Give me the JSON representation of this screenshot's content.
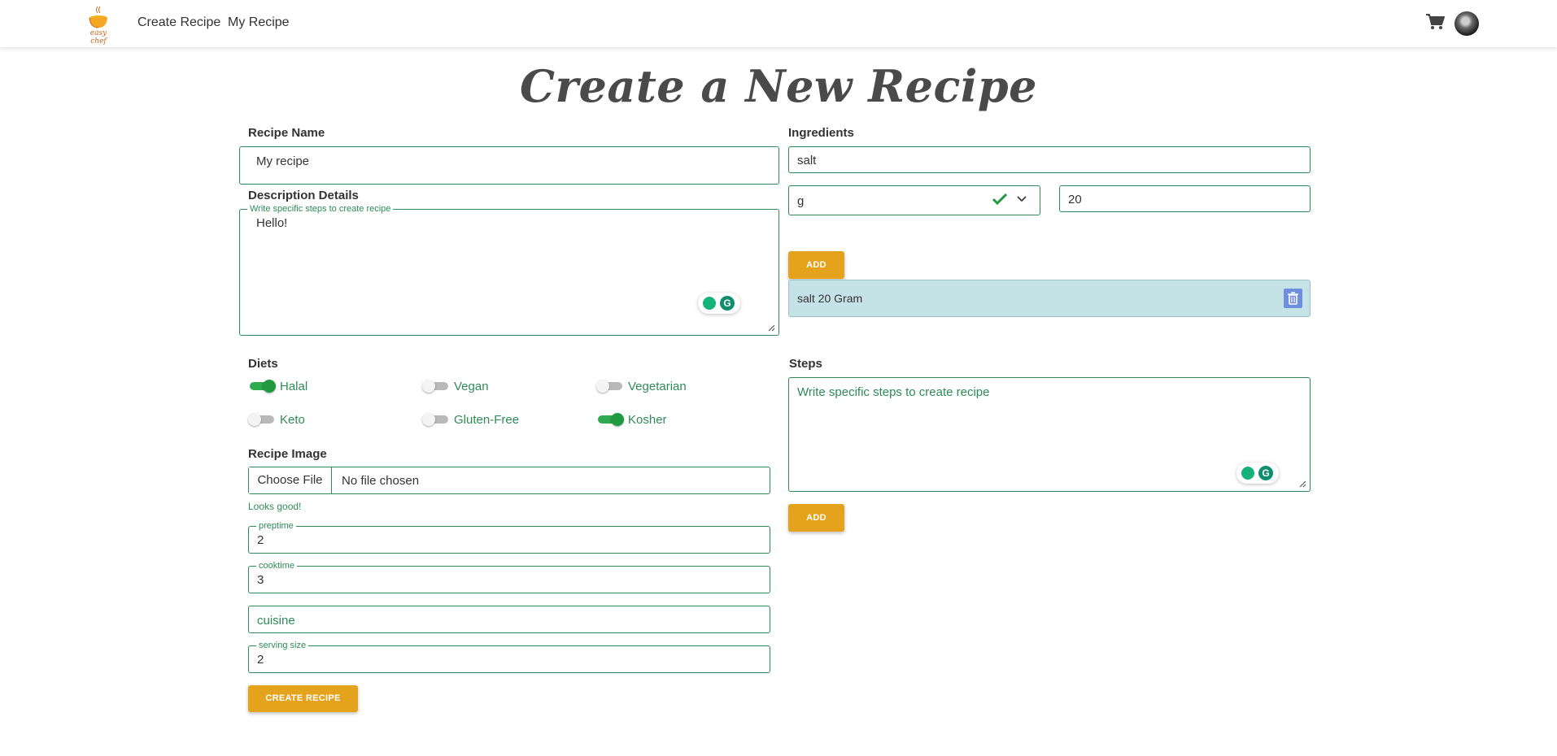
{
  "nav": {
    "logo_text": "easy chef",
    "create_recipe": "Create Recipe",
    "my_recipe": "My Recipe"
  },
  "page_title": "Create a New Recipe",
  "recipe_name": {
    "label": "Recipe Name",
    "value": "My recipe"
  },
  "description": {
    "label": "Description Details",
    "legend": "Write specific steps to create recipe",
    "value": "Hello!"
  },
  "ingredients": {
    "label": "Ingredients",
    "name_value": "salt",
    "unit_value": "g",
    "amount_value": "20",
    "add_label": "ADD",
    "items": [
      {
        "text": "salt 20 Gram"
      }
    ]
  },
  "diets": {
    "label": "Diets",
    "options": [
      {
        "label": "Halal",
        "on": true
      },
      {
        "label": "Vegan",
        "on": false
      },
      {
        "label": "Vegetarian",
        "on": false
      },
      {
        "label": "Keto",
        "on": false
      },
      {
        "label": "Gluten-Free",
        "on": false
      },
      {
        "label": "Kosher",
        "on": true
      }
    ]
  },
  "steps": {
    "label": "Steps",
    "placeholder": "Write specific steps to create recipe",
    "add_label": "ADD"
  },
  "recipe_image": {
    "label": "Recipe Image",
    "choose_file": "Choose File",
    "file_name": "No file chosen",
    "feedback": "Looks good!"
  },
  "preptime": {
    "legend": "preptime",
    "value": "2"
  },
  "cooktime": {
    "legend": "cooktime",
    "value": "3"
  },
  "cuisine": {
    "placeholder": "cuisine"
  },
  "serving_size": {
    "legend": "serving size",
    "value": "2"
  },
  "create_button": "CREATE RECIPE",
  "colors": {
    "accent_green": "#2e8b57",
    "button_orange": "#e5a21c",
    "ingredient_bg": "#c5e2e7",
    "switch_on": "#1f9a40"
  }
}
